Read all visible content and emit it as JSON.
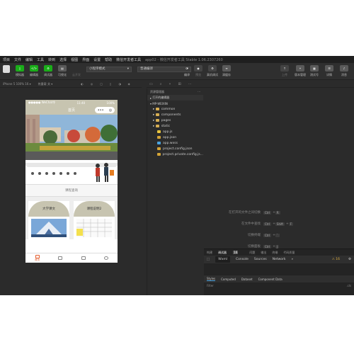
{
  "menu": {
    "items": [
      "项目",
      "文件",
      "编辑",
      "工具",
      "转到",
      "选择",
      "视图",
      "界面",
      "设置",
      "帮助",
      "微信开发者工具"
    ],
    "window_title": "app02 - 微信开发者工具 Stable 1.06.2307260"
  },
  "toolbar": {
    "simulator": "模拟器",
    "editor": "编辑器",
    "debugger": "调试器",
    "visual": "可视化",
    "cloud": "云开发",
    "mode": "小程序模式",
    "compile_mode": "普通编译",
    "compile": "编译",
    "preview": "预览",
    "real_debug": "真机调试",
    "clear_cache": "清缓存",
    "upload": "上传",
    "version": "版本管理",
    "test": "测试号",
    "details": "详情",
    "message": "消息"
  },
  "subbar": {
    "device": "iPhone 5 100% 16 ▾",
    "hot_reload": "热重载 关 ▾"
  },
  "phone": {
    "status_left": "●●●●● WeChat令",
    "status_time": "11:40",
    "status_right": "100%",
    "nav_title": "首页",
    "capsule_dots": "•••",
    "capsule_close": "◎",
    "section_label": "课程查询",
    "card1_title": "大学课文",
    "card2_title": "课程说明2",
    "tabs": [
      "首页",
      "",
      "",
      ""
    ]
  },
  "explorer": {
    "header": "资源管理器",
    "open_editors": "打开的编辑器",
    "project": "MP-WEIXIN",
    "items": [
      {
        "name": "common",
        "type": "folder"
      },
      {
        "name": "components",
        "type": "folder"
      },
      {
        "name": "pages",
        "type": "folder"
      },
      {
        "name": "static",
        "type": "folder"
      },
      {
        "name": "app.js",
        "type": "js"
      },
      {
        "name": "app.json",
        "type": "json"
      },
      {
        "name": "app.wxss",
        "type": "wxss"
      },
      {
        "name": "project.config.json",
        "type": "json"
      },
      {
        "name": "project.private.config.js...",
        "type": "json"
      }
    ]
  },
  "editor_shortcuts": [
    {
      "label": "在打开的文件之间切换",
      "keys": [
        "Ctrl",
        "+",
        "R"
      ]
    },
    {
      "label": "在文件中查找",
      "keys": [
        "Ctrl",
        "+",
        "Shift",
        "+",
        "F"
      ]
    },
    {
      "label": "切换终端",
      "keys": [
        "Ctrl",
        "+",
        "`"
      ]
    },
    {
      "label": "切换面板",
      "keys": [
        "Ctrl",
        "+",
        "J"
      ]
    },
    {
      "label": "切换侧边栏可见性",
      "keys": [
        "Ctrl",
        "+",
        "Shift",
        "+",
        "Alt",
        "+",
        "B"
      ]
    }
  ],
  "devtools": {
    "top_tabs": [
      "构建",
      "调试器",
      "16",
      "问题",
      "输出",
      "终端",
      "代码质量"
    ],
    "panel_tabs": [
      "Wxml",
      "Console",
      "Sources",
      "Network",
      "»"
    ],
    "warn_count": "16",
    "sub_tabs": [
      "Styles",
      "Computed",
      "Dataset",
      "Component Data"
    ],
    "filter": "Filter",
    "cls": ".cls"
  }
}
